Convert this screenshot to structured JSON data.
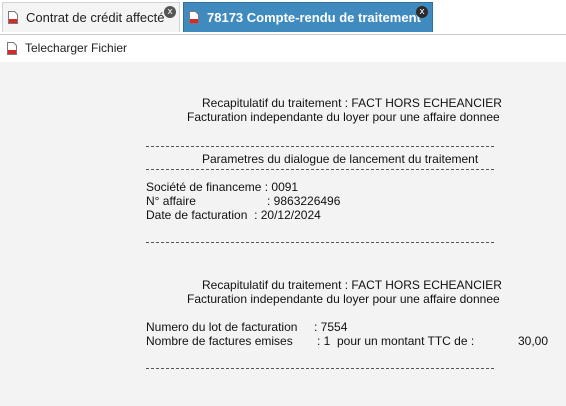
{
  "tabs": [
    {
      "label": "Contrat de crédit affecté",
      "active": false,
      "close": "x"
    },
    {
      "label": "78173 Compte-rendu de traitement",
      "active": true,
      "close": "x"
    }
  ],
  "toolbar": {
    "download_label": "Telecharger Fichier"
  },
  "report": {
    "sep": "---------------------------------------------------------------------------------------------",
    "recap1_title": "Recapitulatif du traitement : FACT HORS ECHEANCIER",
    "recap1_sub": "Facturation independante du loyer pour une affaire donnee",
    "params_title": "Parametres du dialogue de lancement du traitement",
    "societe": "Société de financeme : 0091",
    "affaire_label": "N° affaire",
    "affaire_value": ": 9863226496",
    "date_fact": "Date de facturation  : 20/12/2024",
    "recap2_title": "Recapitulatif du traitement : FACT HORS ECHEANCIER",
    "recap2_sub": "Facturation independante du loyer pour une affaire donnee",
    "lot_label": "Numero du lot de facturation",
    "lot_value": ": 7554",
    "nb_label": "Nombre de factures emises",
    "nb_value": ": 1  pour un montant TTC de :",
    "montant": "30,00"
  },
  "colors": {
    "active_tab": "#3f8bc0",
    "content_bg": "#f3f3f3"
  },
  "icons": [
    "document-icon",
    "close-icon"
  ]
}
